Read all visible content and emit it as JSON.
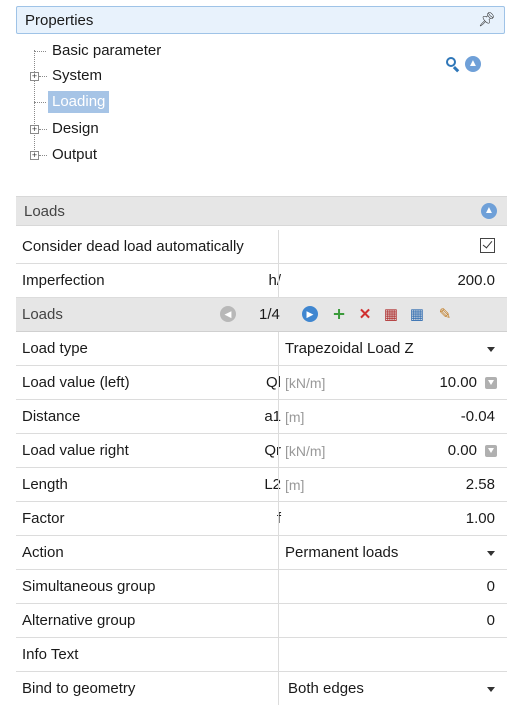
{
  "properties": {
    "title": "Properties",
    "pin_glyph": "\u0002",
    "tree": [
      {
        "label": "Basic parameter",
        "expander": "",
        "selected": false
      },
      {
        "label": "System",
        "expander": "+",
        "selected": false
      },
      {
        "label": "Loading",
        "expander": "",
        "selected": true
      },
      {
        "label": "Design",
        "expander": "+",
        "selected": false
      },
      {
        "label": "Output",
        "expander": "+",
        "selected": false
      }
    ]
  },
  "loads_section": {
    "title": "Loads",
    "collapse_glyph": "\u0002"
  },
  "grid": {
    "consider_dead_load": {
      "name": "Consider dead load automatically",
      "checked": true
    },
    "imperfection": {
      "name": "Imperfection",
      "symbol": "h/",
      "value": "200.0"
    },
    "loads_nav": {
      "name": "Loads",
      "counter": "1/4"
    },
    "load_type": {
      "name": "Load type",
      "value": "Trapezoidal Load Z"
    },
    "load_value_left": {
      "name": "Load value (left)",
      "symbol": "Ql",
      "unit": "[kN/m]",
      "value": "10.00"
    },
    "distance": {
      "name": "Distance",
      "symbol": "a1",
      "unit": "[m]",
      "value": "-0.04"
    },
    "load_value_right": {
      "name": "Load value right",
      "symbol": "Qr",
      "unit": "[kN/m]",
      "value": "0.00"
    },
    "length": {
      "name": "Length",
      "symbol": "L2",
      "unit": "[m]",
      "value": "2.58"
    },
    "factor": {
      "name": "Factor",
      "symbol": "f",
      "value": "1.00"
    },
    "action": {
      "name": "Action",
      "value": "Permanent loads"
    },
    "simultaneous_group": {
      "name": "Simultaneous group",
      "value": "0"
    },
    "alternative_group": {
      "name": "Alternative group",
      "value": "0"
    },
    "info_text": {
      "name": "Info Text",
      "value": ""
    },
    "bind_to_geometry": {
      "name": "Bind to geometry",
      "value": "Both edges"
    }
  },
  "colors": {
    "accent": "#6fa0d8",
    "header_bg": "#e8f2fc",
    "section_bg": "#e6e6e6",
    "selected_bg": "#a6c4e6"
  }
}
